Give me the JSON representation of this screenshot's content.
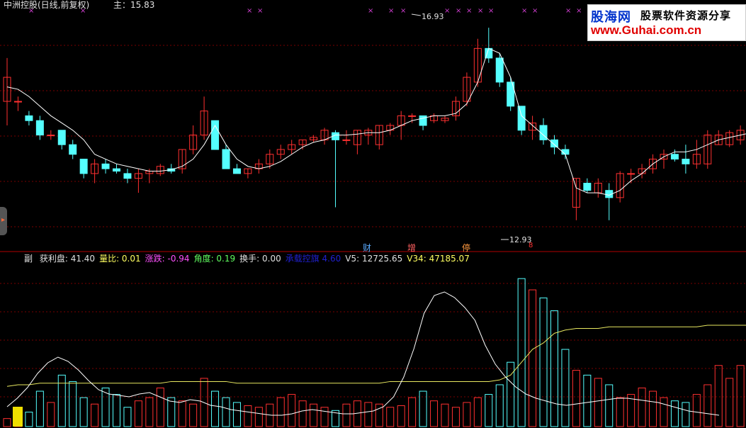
{
  "header": {
    "title": "中洲控股(日线,前复权)",
    "main_label": "主：15.83"
  },
  "logo": {
    "line1_a": "股海网",
    "line1_b": "股票软件资源分享",
    "line2": "www.Guhai.com.cn"
  },
  "price_markers": {
    "high": "16.93",
    "low": "12.93"
  },
  "event_tags": [
    "财",
    "增",
    "停",
    "8"
  ],
  "sub_indicator": {
    "name": "副",
    "items": [
      {
        "label": "获利盘:",
        "value": "41.40",
        "color": "#e0e0e0"
      },
      {
        "label": "量比:",
        "value": "0.01",
        "color": "#ffff60"
      },
      {
        "label": "涨跌:",
        "value": "-0.94",
        "color": "#ff50ff"
      },
      {
        "label": "角度:",
        "value": "0.19",
        "color": "#60ff60"
      },
      {
        "label": "换手:",
        "value": "0.00",
        "color": "#e0e0e0"
      },
      {
        "label": "承载控旗",
        "value": "4.60",
        "color": "#2020d0"
      },
      {
        "label": "V5:",
        "value": "12725.65",
        "color": "#e0e0e0"
      },
      {
        "label": "V34:",
        "value": "47185.07",
        "color": "#ffff60"
      }
    ]
  },
  "colors": {
    "up": "#ff3030",
    "down": "#54ffff",
    "ma": "#ffffff",
    "vol_ma": "#e8e860",
    "grid": "#7a0000"
  },
  "chart_data": [
    {
      "type": "candlestick",
      "title": "中洲控股(日线,前复权)",
      "ylim": [
        12.5,
        17.3
      ],
      "candles": [
        [
          15.4,
          16.3,
          14.9,
          15.9
        ],
        [
          15.4,
          15.5,
          15.2,
          15.4
        ],
        [
          15.1,
          15.2,
          14.9,
          15.0
        ],
        [
          15.0,
          15.1,
          14.6,
          14.7
        ],
        [
          14.7,
          14.8,
          14.6,
          14.7
        ],
        [
          14.8,
          14.8,
          14.4,
          14.5
        ],
        [
          14.5,
          14.6,
          14.2,
          14.3
        ],
        [
          14.2,
          14.2,
          13.8,
          13.9
        ],
        [
          13.9,
          14.2,
          13.7,
          14.1
        ],
        [
          14.1,
          14.2,
          13.9,
          14.0
        ],
        [
          14.0,
          14.1,
          13.9,
          13.95
        ],
        [
          13.9,
          14.0,
          13.7,
          13.8
        ],
        [
          13.8,
          14.0,
          13.5,
          13.9
        ],
        [
          13.9,
          14.0,
          13.7,
          13.95
        ],
        [
          13.9,
          14.1,
          13.85,
          14.05
        ],
        [
          14.0,
          14.1,
          13.9,
          13.95
        ],
        [
          14.0,
          14.4,
          13.9,
          14.4
        ],
        [
          14.4,
          14.9,
          14.3,
          14.7
        ],
        [
          14.7,
          15.5,
          14.6,
          15.2
        ],
        [
          15.0,
          15.0,
          14.4,
          14.4
        ],
        [
          14.4,
          14.5,
          14.0,
          14.0
        ],
        [
          14.0,
          14.1,
          13.9,
          13.9
        ],
        [
          13.9,
          14.0,
          13.8,
          14.0
        ],
        [
          14.0,
          14.2,
          13.9,
          14.1
        ],
        [
          14.1,
          14.4,
          14.0,
          14.3
        ],
        [
          14.3,
          14.5,
          14.2,
          14.4
        ],
        [
          14.4,
          14.6,
          14.3,
          14.5
        ],
        [
          14.5,
          14.6,
          14.4,
          14.6
        ],
        [
          14.6,
          14.7,
          14.55,
          14.65
        ],
        [
          14.6,
          14.85,
          14.5,
          14.8
        ],
        [
          14.75,
          14.8,
          13.2,
          14.6
        ],
        [
          14.6,
          14.8,
          14.5,
          14.6
        ],
        [
          14.5,
          14.8,
          14.3,
          14.8
        ],
        [
          14.7,
          14.85,
          14.5,
          14.8
        ],
        [
          14.5,
          14.9,
          14.4,
          14.9
        ],
        [
          14.8,
          14.95,
          14.7,
          14.9
        ],
        [
          14.9,
          15.2,
          14.6,
          15.1
        ],
        [
          15.1,
          15.15,
          14.95,
          15.1
        ],
        [
          15.1,
          15.1,
          14.8,
          14.9
        ],
        [
          15.0,
          15.15,
          14.95,
          15.1
        ],
        [
          15.0,
          15.1,
          14.95,
          15.05
        ],
        [
          15.1,
          15.5,
          15.0,
          15.4
        ],
        [
          15.4,
          16.0,
          15.3,
          15.9
        ],
        [
          15.8,
          16.7,
          15.7,
          16.5
        ],
        [
          16.5,
          16.93,
          16.2,
          16.3
        ],
        [
          16.3,
          16.4,
          15.7,
          15.8
        ],
        [
          15.8,
          15.9,
          15.2,
          15.3
        ],
        [
          15.3,
          15.3,
          14.7,
          14.8
        ],
        [
          14.8,
          15.1,
          14.6,
          14.95
        ],
        [
          14.9,
          15.05,
          14.5,
          14.6
        ],
        [
          14.6,
          14.7,
          14.3,
          14.45
        ],
        [
          14.4,
          14.5,
          14.2,
          14.3
        ],
        [
          13.2,
          13.8,
          12.93,
          13.8
        ],
        [
          13.7,
          13.8,
          13.5,
          13.55
        ],
        [
          13.5,
          13.8,
          13.4,
          13.7
        ],
        [
          13.55,
          13.7,
          12.93,
          13.4
        ],
        [
          13.4,
          13.95,
          13.3,
          13.9
        ],
        [
          13.9,
          14.0,
          13.7,
          13.9
        ],
        [
          13.9,
          14.1,
          13.8,
          14.0
        ],
        [
          14.0,
          14.3,
          13.9,
          14.2
        ],
        [
          14.2,
          14.4,
          14.0,
          14.3
        ],
        [
          14.3,
          14.4,
          14.15,
          14.2
        ],
        [
          14.2,
          14.5,
          13.9,
          14.1
        ],
        [
          14.1,
          14.6,
          14.0,
          14.3
        ],
        [
          14.1,
          14.8,
          14.0,
          14.7
        ],
        [
          14.5,
          14.8,
          14.5,
          14.7
        ],
        [
          14.5,
          14.8,
          14.45,
          14.75
        ],
        [
          14.6,
          14.9,
          14.5,
          14.8
        ],
        [
          14.6,
          14.9,
          14.55,
          14.85
        ],
        [
          14.75,
          15.0,
          14.7,
          14.9
        ],
        [
          14.9,
          15.15,
          14.8,
          15.1
        ],
        [
          15.0,
          15.3,
          14.9,
          15.25
        ],
        [
          15.0,
          15.6,
          14.9,
          15.6
        ],
        [
          15.4,
          16.5,
          15.35,
          16.2
        ],
        [
          16.2,
          16.2,
          15.9,
          15.95
        ],
        [
          15.9,
          16.1,
          15.8,
          16.0
        ],
        [
          15.8,
          16.1,
          15.8,
          16.1
        ],
        [
          16.0,
          16.1,
          15.75,
          15.8
        ],
        [
          15.85,
          16.05,
          15.85,
          16.0
        ],
        [
          15.9,
          16.1,
          15.85,
          16.05
        ],
        [
          16.05,
          16.2,
          15.9,
          15.9
        ],
        [
          16.0,
          16.1,
          16.0,
          16.05
        ]
      ],
      "ma_line": [
        15.7,
        15.65,
        15.5,
        15.3,
        15.1,
        14.95,
        14.8,
        14.6,
        14.3,
        14.2,
        14.1,
        14.05,
        14.0,
        13.95,
        13.95,
        13.98,
        14.05,
        14.2,
        14.5,
        14.9,
        14.5,
        14.2,
        14.05,
        14.0,
        14.05,
        14.15,
        14.3,
        14.45,
        14.55,
        14.6,
        14.7,
        14.7,
        14.72,
        14.75,
        14.75,
        14.8,
        14.9,
        15.0,
        15.05,
        15.1,
        15.1,
        15.15,
        15.35,
        15.8,
        16.5,
        16.4,
        15.9,
        15.1,
        14.9,
        14.7,
        14.5,
        14.3,
        13.6,
        13.5,
        13.5,
        13.45,
        13.55,
        13.75,
        13.9,
        14.1,
        14.25,
        14.35,
        14.35,
        14.4,
        14.5,
        14.6,
        14.65,
        14.7,
        14.75,
        14.8,
        14.9,
        15.05,
        15.25,
        15.6,
        16.0,
        15.95,
        15.95,
        15.95,
        15.95,
        15.95,
        16.0,
        16.0
      ]
    },
    {
      "type": "bar",
      "title": "副",
      "volume": [
        5,
        12,
        9,
        22,
        15,
        32,
        28,
        18,
        14,
        24,
        20,
        12,
        16,
        18,
        24,
        18,
        16,
        14,
        30,
        22,
        18,
        15,
        13,
        12,
        14,
        18,
        20,
        16,
        14,
        12,
        10,
        14,
        16,
        15,
        14,
        12,
        13,
        18,
        22,
        16,
        14,
        12,
        15,
        18,
        20,
        26,
        40,
        92,
        85,
        80,
        72,
        48,
        35,
        32,
        30,
        26,
        18,
        20,
        24,
        22,
        18,
        16,
        15,
        20,
        26,
        38,
        30,
        38,
        22,
        20,
        16,
        18,
        20,
        22,
        26,
        20,
        18,
        16,
        14,
        12,
        10,
        14,
        18,
        16
      ],
      "volume_ma": [
        25,
        26,
        26,
        27,
        27,
        27,
        27,
        27,
        27,
        27,
        27,
        27,
        27,
        27,
        27,
        28,
        28,
        28,
        28,
        28,
        28,
        27,
        27,
        27,
        27,
        27,
        27,
        27,
        27,
        27,
        27,
        27,
        27,
        27,
        27,
        28,
        28,
        28,
        28,
        28,
        28,
        28,
        28,
        28,
        28,
        29,
        32,
        40,
        48,
        52,
        58,
        60,
        61,
        61,
        61,
        62,
        62,
        62,
        62,
        62,
        62,
        62,
        62,
        62,
        63,
        63,
        63,
        63,
        63,
        63,
        63,
        63,
        63,
        63,
        63,
        63,
        63,
        63,
        63,
        63,
        63,
        63,
        63,
        63
      ],
      "profit_line": [
        28,
        40,
        55,
        75,
        90,
        98,
        92,
        80,
        65,
        52,
        46,
        44,
        42,
        46,
        48,
        42,
        36,
        34,
        38,
        36,
        30,
        28,
        24,
        22,
        20,
        18,
        16,
        16,
        18,
        22,
        24,
        22,
        20,
        18,
        18,
        20,
        22,
        28,
        42,
        70,
        110,
        160,
        185,
        190,
        182,
        168,
        150,
        115,
        88,
        70,
        56,
        46,
        40,
        36,
        32,
        30,
        32,
        34,
        36,
        38,
        40,
        40,
        38,
        36,
        34,
        30,
        26,
        22,
        20,
        18,
        16
      ]
    }
  ]
}
